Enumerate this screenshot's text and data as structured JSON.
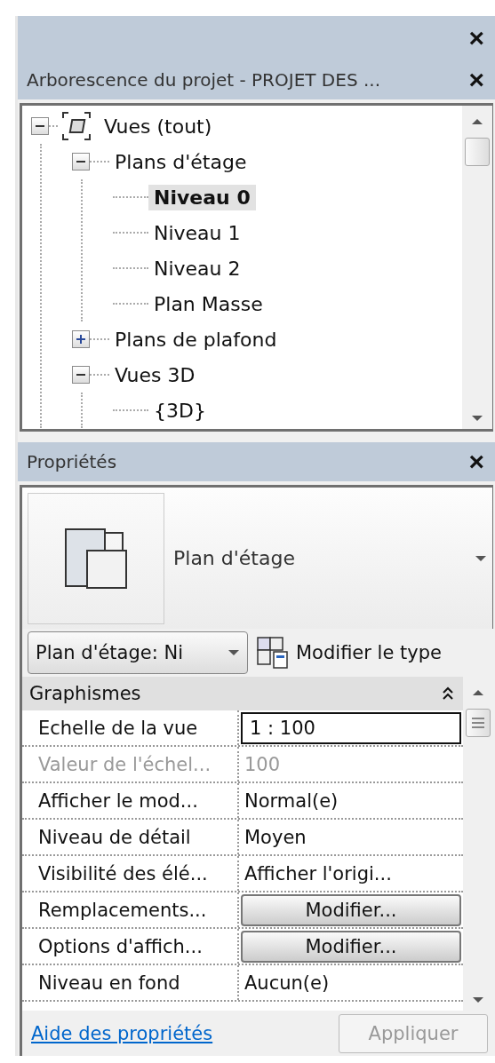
{
  "browser_panel": {
    "title": "Arborescence du projet - PROJET DES ...",
    "close_label": "×",
    "tree": [
      {
        "label": "Vues (tout)",
        "kind": "root",
        "expanded": true,
        "selected": false,
        "children": [
          {
            "label": "Plans d'étage",
            "kind": "folder",
            "expanded": true,
            "selected": false,
            "children": [
              {
                "label": "Niveau 0",
                "kind": "leaf",
                "selected": true
              },
              {
                "label": "Niveau 1",
                "kind": "leaf",
                "selected": false
              },
              {
                "label": "Niveau 2",
                "kind": "leaf",
                "selected": false
              },
              {
                "label": "Plan Masse",
                "kind": "leaf",
                "selected": false
              }
            ]
          },
          {
            "label": "Plans de plafond",
            "kind": "folder",
            "expanded": false,
            "selected": false
          },
          {
            "label": "Vues 3D",
            "kind": "folder",
            "expanded": true,
            "selected": false,
            "children": [
              {
                "label": "{3D}",
                "kind": "leaf",
                "selected": false
              }
            ]
          }
        ]
      }
    ]
  },
  "top_close_label": "×",
  "properties_panel": {
    "title": "Propriétés",
    "close_label": "×",
    "type_name": "Plan d'étage",
    "instance_selector": "Plan d'étage: Ni",
    "edit_type_label": "Modifier le type",
    "group": {
      "label": "Graphismes",
      "expanded": true
    },
    "rows": [
      {
        "label": "Echelle de la vue",
        "kind": "field",
        "value": "1 : 100",
        "disabled": false
      },
      {
        "label": "Valeur de l'échel...",
        "kind": "text",
        "value": "100",
        "disabled": true
      },
      {
        "label": "Afficher le mod...",
        "kind": "text",
        "value": "Normal(e)",
        "disabled": false
      },
      {
        "label": "Niveau de détail",
        "kind": "text",
        "value": "Moyen",
        "disabled": false
      },
      {
        "label": "Visibilité des élé...",
        "kind": "text",
        "value": "Afficher l'origi...",
        "disabled": false
      },
      {
        "label": "Remplacements...",
        "kind": "button",
        "value": "Modifier...",
        "disabled": false
      },
      {
        "label": "Options d'affich...",
        "kind": "button",
        "value": "Modifier...",
        "disabled": false
      },
      {
        "label": "Niveau en fond",
        "kind": "text",
        "value": "Aucun(e)",
        "disabled": false
      }
    ],
    "help_link": "Aide des propriétés",
    "apply_button": {
      "label": "Appliquer",
      "disabled": true
    }
  }
}
